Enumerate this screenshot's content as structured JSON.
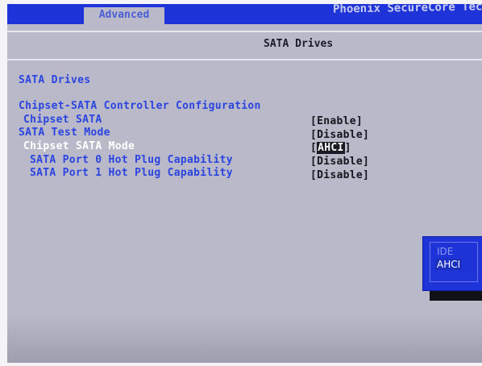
{
  "topbar": {
    "tab_label": "Advanced",
    "brand": "Phoenix SecureCore Tec"
  },
  "header": {
    "title": "SATA Drives"
  },
  "section": {
    "title": "SATA Drives",
    "group": "Chipset-SATA Controller Configuration"
  },
  "settings": [
    {
      "label": "Chipset SATA",
      "value": "[Enable]"
    },
    {
      "label": "SATA Test Mode",
      "value": "[Disable]"
    },
    {
      "label": "Chipset SATA Mode",
      "value_open": "[",
      "value_sel": "AHCI",
      "value_close": "]"
    },
    {
      "label": "SATA Port 0 Hot Plug Capability",
      "value": "[Disable]"
    },
    {
      "label": "SATA Port 1 Hot Plug Capability",
      "value": "[Disable]"
    }
  ],
  "popup": {
    "options": [
      "IDE",
      "AHCI"
    ],
    "selected": "AHCI"
  },
  "colors": {
    "accent": "#1e34d8",
    "background": "#b9b9c9",
    "text_blue": "#2b44e0",
    "highlight": "#ffffff"
  }
}
